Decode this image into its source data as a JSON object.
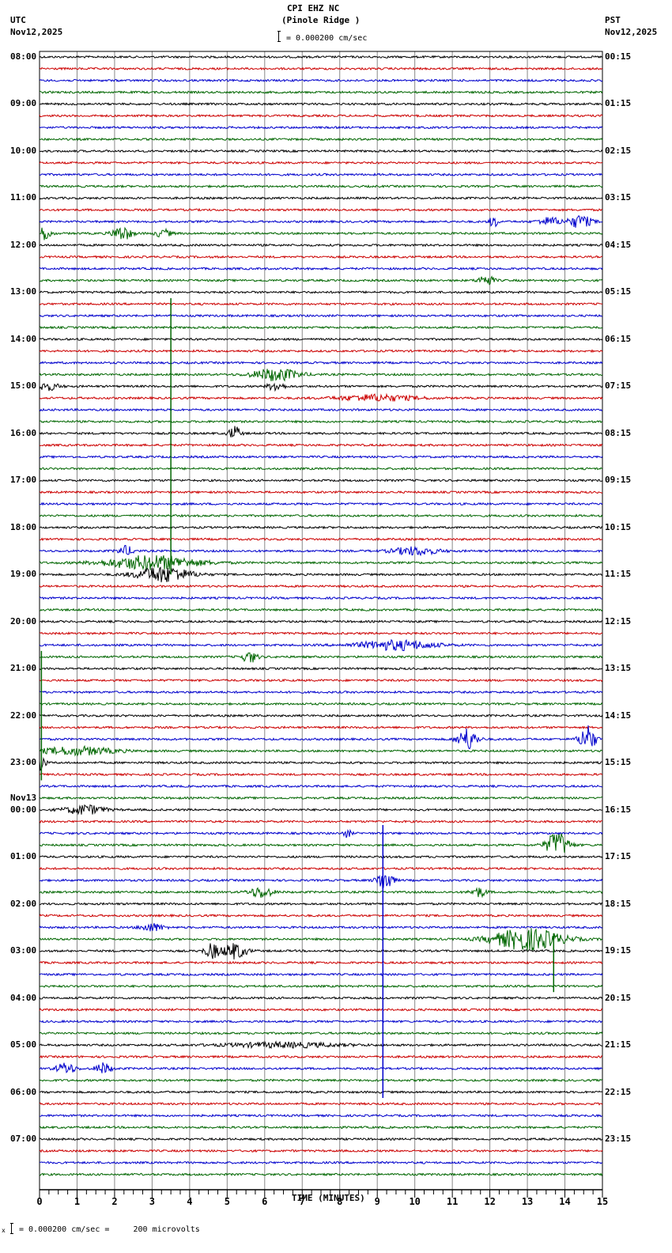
{
  "header": {
    "station": "CPI EHZ NC",
    "location": "(Pinole Ridge )",
    "left_tz": "UTC",
    "left_date": "Nov12,2025",
    "right_tz": "PST",
    "right_date": "Nov12,2025",
    "scale_text": "= 0.000200 cm/sec"
  },
  "footer": {
    "scale_text": "= 0.000200 cm/sec =     200 microvolts",
    "mark": "x"
  },
  "chart_data": {
    "type": "line",
    "title": "CPI EHZ NC (Pinole Ridge )",
    "xlabel": "TIME (MINUTES)",
    "xlim": [
      0,
      15
    ],
    "x_ticks": [
      "0",
      "1",
      "2",
      "3",
      "4",
      "5",
      "6",
      "7",
      "8",
      "9",
      "10",
      "11",
      "12",
      "13",
      "14",
      "15"
    ],
    "traces_per_hour": 4,
    "trace_colors": [
      "#000000",
      "#cc0000",
      "#0000cc",
      "#006600"
    ],
    "left_labels": [
      "08:00",
      "09:00",
      "10:00",
      "11:00",
      "12:00",
      "13:00",
      "14:00",
      "15:00",
      "16:00",
      "17:00",
      "18:00",
      "19:00",
      "20:00",
      "21:00",
      "22:00",
      "23:00",
      "00:00",
      "01:00",
      "02:00",
      "03:00",
      "04:00",
      "05:00",
      "06:00",
      "07:00"
    ],
    "date_change_label": "Nov13",
    "date_change_hour_index": 16,
    "right_labels": [
      "00:15",
      "01:15",
      "02:15",
      "03:15",
      "04:15",
      "05:15",
      "06:15",
      "07:15",
      "08:15",
      "09:15",
      "10:15",
      "11:15",
      "12:15",
      "13:15",
      "14:15",
      "15:15",
      "16:15",
      "17:15",
      "18:15",
      "19:15",
      "20:15",
      "21:15",
      "22:15",
      "23:15"
    ],
    "events": [
      {
        "row": 14,
        "minute": 12.1,
        "amp": 8,
        "dur": 0.1
      },
      {
        "row": 14,
        "minute": 13.6,
        "amp": 5,
        "dur": 0.3
      },
      {
        "row": 14,
        "minute": 14.4,
        "amp": 8,
        "dur": 0.3
      },
      {
        "row": 15,
        "minute": 0.15,
        "amp": 9,
        "dur": 0.15
      },
      {
        "row": 15,
        "minute": 2.2,
        "amp": 9,
        "dur": 0.25
      },
      {
        "row": 15,
        "minute": 3.3,
        "amp": 5,
        "dur": 0.2
      },
      {
        "row": 19,
        "minute": 11.9,
        "amp": 7,
        "dur": 0.2
      },
      {
        "row": 27,
        "minute": 6.3,
        "amp": 8,
        "dur": 0.6
      },
      {
        "row": 28,
        "minute": 0.2,
        "amp": 5,
        "dur": 0.3
      },
      {
        "row": 28,
        "minute": 6.3,
        "amp": 6,
        "dur": 0.2
      },
      {
        "row": 29,
        "minute": 9.0,
        "amp": 4,
        "dur": 1.0
      },
      {
        "row": 32,
        "minute": 5.2,
        "amp": 9,
        "dur": 0.15
      },
      {
        "row": 42,
        "minute": 2.3,
        "amp": 6,
        "dur": 0.2
      },
      {
        "row": 42,
        "minute": 10.0,
        "amp": 5,
        "dur": 0.6
      },
      {
        "row": 43,
        "minute": 3.0,
        "amp": 9,
        "dur": 1.2
      },
      {
        "row": 44,
        "minute": 3.3,
        "amp": 10,
        "dur": 0.7
      },
      {
        "row": 50,
        "minute": 9.5,
        "amp": 6,
        "dur": 1.0
      },
      {
        "row": 51,
        "minute": 5.6,
        "amp": 7,
        "dur": 0.2
      },
      {
        "row": 58,
        "minute": 11.4,
        "amp": 14,
        "dur": 0.25
      },
      {
        "row": 58,
        "minute": 14.6,
        "amp": 18,
        "dur": 0.2
      },
      {
        "row": 59,
        "minute": 1.0,
        "amp": 5,
        "dur": 1.0
      },
      {
        "row": 60,
        "minute": 0.05,
        "amp": 12,
        "dur": 0.1
      },
      {
        "row": 64,
        "minute": 1.2,
        "amp": 6,
        "dur": 0.5
      },
      {
        "row": 66,
        "minute": 8.2,
        "amp": 5,
        "dur": 0.1
      },
      {
        "row": 67,
        "minute": 13.8,
        "amp": 16,
        "dur": 0.3
      },
      {
        "row": 70,
        "minute": 9.2,
        "amp": 14,
        "dur": 0.2
      },
      {
        "row": 71,
        "minute": 5.9,
        "amp": 7,
        "dur": 0.3
      },
      {
        "row": 71,
        "minute": 11.7,
        "amp": 6,
        "dur": 0.2
      },
      {
        "row": 74,
        "minute": 3.0,
        "amp": 5,
        "dur": 0.3
      },
      {
        "row": 75,
        "minute": 13.0,
        "amp": 14,
        "dur": 0.9
      },
      {
        "row": 76,
        "minute": 4.6,
        "amp": 9,
        "dur": 0.2
      },
      {
        "row": 76,
        "minute": 5.2,
        "amp": 10,
        "dur": 0.3
      },
      {
        "row": 84,
        "minute": 6.5,
        "amp": 3,
        "dur": 1.5
      },
      {
        "row": 86,
        "minute": 0.7,
        "amp": 7,
        "dur": 0.25
      },
      {
        "row": 86,
        "minute": 1.7,
        "amp": 7,
        "dur": 0.2
      }
    ],
    "spikes": [
      {
        "row": 43,
        "minute": 3.5,
        "up_rows": 22.5,
        "down_rows": 1
      },
      {
        "row": 59,
        "minute": 0.05,
        "up_rows": 8.5,
        "down_rows": 2.5
      },
      {
        "row": 70,
        "minute": 9.15,
        "up_rows": 4.7,
        "down_rows": 18.5
      },
      {
        "row": 75,
        "minute": 13.7,
        "up_rows": 0.5,
        "down_rows": 4.5
      }
    ]
  }
}
